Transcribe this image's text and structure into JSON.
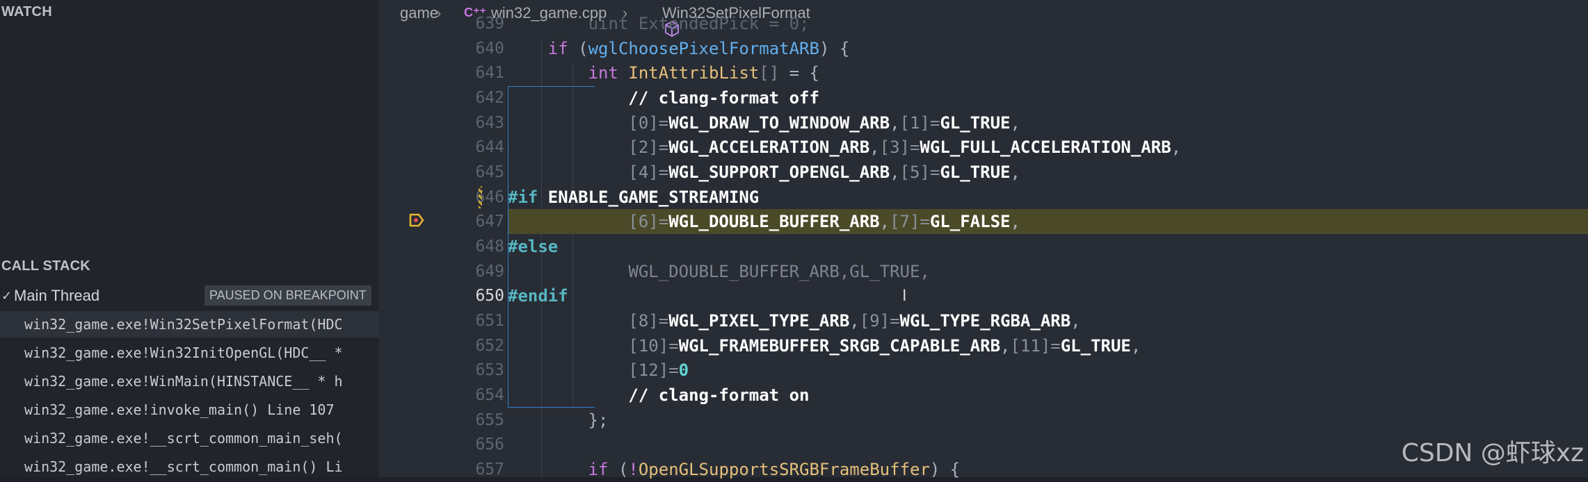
{
  "watch": {
    "title": "WATCH"
  },
  "call_stack": {
    "title": "CALL STACK",
    "thread": {
      "chevron": "✓",
      "name": "Main Thread",
      "status": "PAUSED ON BREAKPOINT"
    },
    "frames": [
      "win32_game.exe!Win32SetPixelFormat(HDC",
      "win32_game.exe!Win32InitOpenGL(HDC__ *",
      "win32_game.exe!WinMain(HINSTANCE__ * h",
      "win32_game.exe!invoke_main() Line 107",
      "win32_game.exe!__scrt_common_main_seh(",
      "win32_game.exe!__scrt_common_main() Li"
    ]
  },
  "breadcrumb": {
    "folder": "game",
    "file_icon": "C⁺⁺",
    "file": "win32_game.cpp",
    "symbol_icon": "cube-icon",
    "symbol": "Win32SetPixelFormat"
  },
  "editor": {
    "active_line": "650",
    "breakpoint_line": "647",
    "lines": [
      {
        "num": "639",
        "text": "        uint ExtendedPick = 0;"
      },
      {
        "num": "640",
        "text": "    if (wglChoosePixelFormatARB) {"
      },
      {
        "num": "641",
        "text": "        int IntAttribList[] = {"
      },
      {
        "num": "642",
        "text": "            // clang-format off"
      },
      {
        "num": "643",
        "text": "            [0]=WGL_DRAW_TO_WINDOW_ARB,[1]=GL_TRUE,"
      },
      {
        "num": "644",
        "text": "            [2]=WGL_ACCELERATION_ARB,[3]=WGL_FULL_ACCELERATION_ARB,"
      },
      {
        "num": "645",
        "text": "            [4]=WGL_SUPPORT_OPENGL_ARB,[5]=GL_TRUE,"
      },
      {
        "num": "646",
        "text": "#if ENABLE_GAME_STREAMING"
      },
      {
        "num": "647",
        "text": "            [6]=WGL_DOUBLE_BUFFER_ARB,[7]=GL_FALSE,"
      },
      {
        "num": "648",
        "text": "#else"
      },
      {
        "num": "649",
        "text": "            WGL_DOUBLE_BUFFER_ARB,GL_TRUE,"
      },
      {
        "num": "650",
        "text": "#endif"
      },
      {
        "num": "651",
        "text": "            [8]=WGL_PIXEL_TYPE_ARB,[9]=WGL_TYPE_RGBA_ARB,"
      },
      {
        "num": "652",
        "text": "            [10]=WGL_FRAMEBUFFER_SRGB_CAPABLE_ARB,[11]=GL_TRUE,"
      },
      {
        "num": "653",
        "text": "            [12]=0"
      },
      {
        "num": "654",
        "text": "            // clang-format on"
      },
      {
        "num": "655",
        "text": "        };"
      },
      {
        "num": "656",
        "text": ""
      },
      {
        "num": "657",
        "text": "        if (!OpenGLSupportsSRGBFrameBuffer) {"
      }
    ]
  },
  "watermark": "CSDN @虾球xz",
  "colors": {
    "sidebar_bg": "#21252b",
    "editor_bg": "#282c34",
    "highlight_line": "#4b4a28",
    "breakpoint": "#e8b730",
    "scope_guide": "#2f80c8"
  }
}
